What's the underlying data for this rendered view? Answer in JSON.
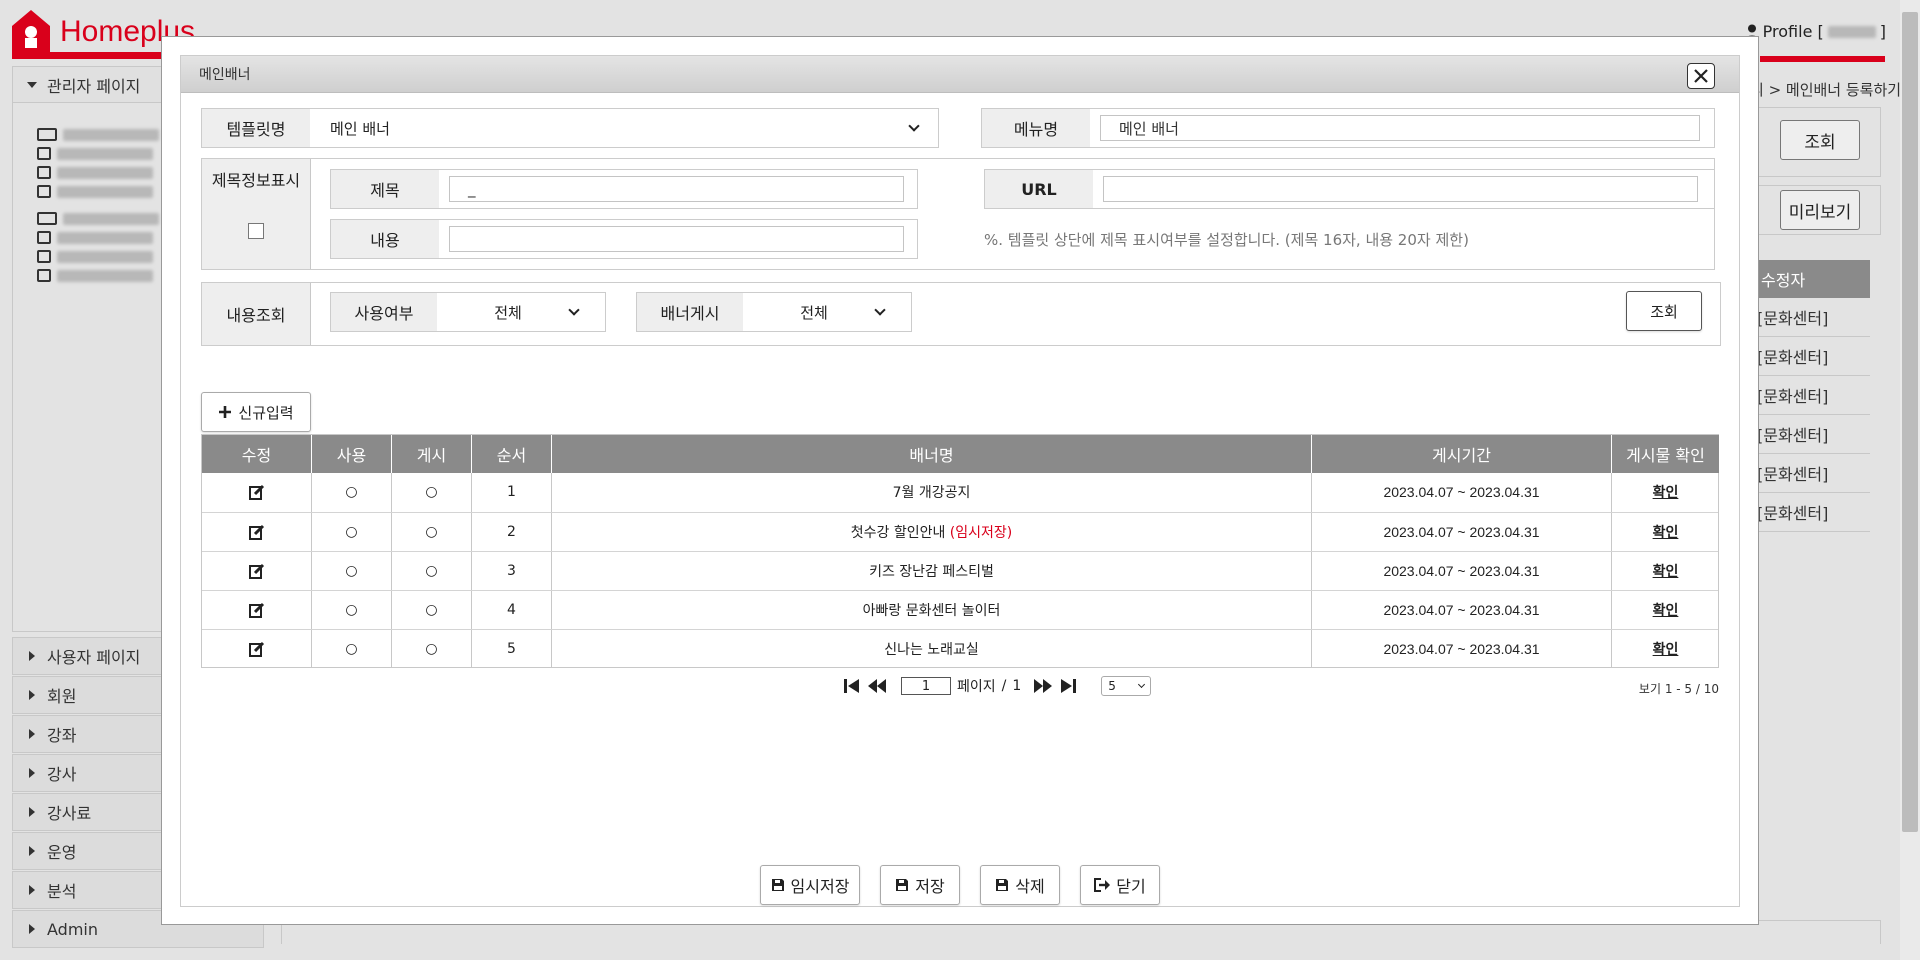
{
  "background": {
    "logo_text": "Homeplus",
    "profile_label": "Profile [",
    "profile_close": "]",
    "sidebar_title": "관리자 페이지",
    "menu_items": [
      "사용자 페이지",
      "회원",
      "강좌",
      "강사",
      "강사료",
      "운영",
      "분석",
      "Admin"
    ],
    "breadcrumb": "리 > 메인배너 등록하기",
    "search_btn": "조회",
    "preview_btn": "미리보기",
    "table_header": "수정자",
    "table_rows": [
      "[문화센터]",
      "[문화센터]",
      "[문화센터]",
      "[문화센터]",
      "[문화센터]",
      "[문화센터]"
    ]
  },
  "modal": {
    "title": "메인배너",
    "template_label": "템플릿명",
    "template_value": "메인 배너",
    "menu_label": "메뉴명",
    "menu_value": "메인 배너",
    "title_display_label": "제목정보표시",
    "subject_label": "제목",
    "subject_value": "_",
    "url_label": "URL",
    "url_value": "",
    "content_label": "내용",
    "content_value": "",
    "hint": "%. 템플릿 상단에 제목 표시여부를 설정합니다. (제목 16자, 내용 20자 제한)",
    "search_section_label": "내용조회",
    "use_label": "사용여부",
    "use_value": "전체",
    "post_label": "배너게시",
    "post_value": "전체",
    "search_btn": "조회",
    "new_btn": "신규입력",
    "table": {
      "headers": [
        "수정",
        "사용",
        "게시",
        "순서",
        "배너명",
        "게시기간",
        "게시물 확인"
      ],
      "rows": [
        {
          "use": "○",
          "post": "○",
          "order": "1",
          "name": "7월 개강공지",
          "name_suffix": "",
          "period": "2023.04.07 ~ 2023.04.31",
          "check": "확인"
        },
        {
          "use": "○",
          "post": "○",
          "order": "2",
          "name": "첫수강 할인안내 ",
          "name_suffix": "(임시저장)",
          "period": "2023.04.07 ~ 2023.04.31",
          "check": "확인"
        },
        {
          "use": "○",
          "post": "○",
          "order": "3",
          "name": "키즈 장난감 페스티벌",
          "name_suffix": "",
          "period": "2023.04.07 ~ 2023.04.31",
          "check": "확인"
        },
        {
          "use": "○",
          "post": "○",
          "order": "4",
          "name": "아빠랑 문화센터 놀이터",
          "name_suffix": "",
          "period": "2023.04.07 ~ 2023.04.31",
          "check": "확인"
        },
        {
          "use": "○",
          "post": "○",
          "order": "5",
          "name": "신나는 노래교실",
          "name_suffix": "",
          "period": "2023.04.07 ~ 2023.04.31",
          "check": "확인"
        }
      ]
    },
    "pager": {
      "page_value": "1",
      "page_label": "페이지",
      "separator": "/",
      "total_pages": "1",
      "page_size": "5",
      "summary": "보기 1 - 5 / 10"
    },
    "footer": {
      "temp_save": "임시저장",
      "save": "저장",
      "delete": "삭제",
      "close": "닫기"
    },
    "colors": {
      "accent": "#d9001b",
      "table_header": "#8a8a8a"
    }
  }
}
